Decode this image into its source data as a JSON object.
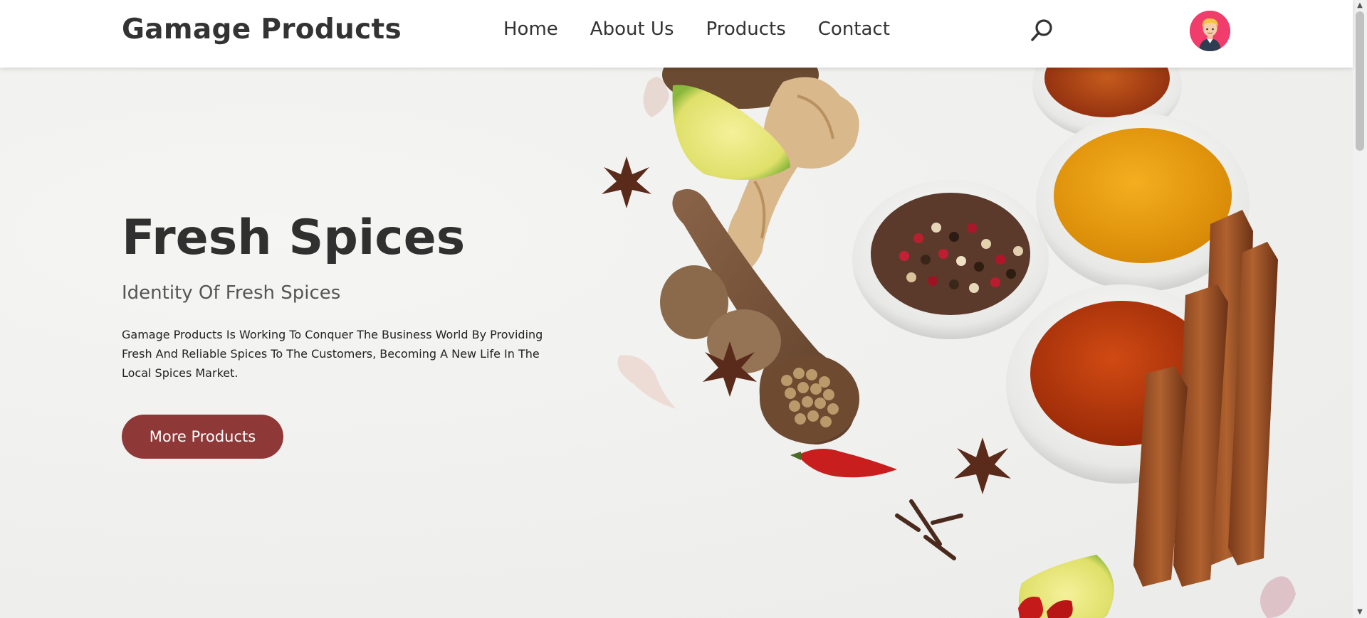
{
  "header": {
    "brand": "Gamage Products",
    "nav": [
      "Home",
      "About Us",
      "Products",
      "Contact"
    ]
  },
  "hero": {
    "title": "Fresh Spices",
    "subtitle": "Identity Of Fresh Spices",
    "description": "Gamage Products Is Working To Conquer The Business World By Providing Fresh And Reliable Spices To The Customers, Becoming A New Life In The Local Spices Market.",
    "cta_label": "More Products"
  },
  "colors": {
    "cta_background": "#8e3838",
    "avatar_background": "#f03d6b",
    "text_dark": "#333333"
  },
  "icons": {
    "search": "search-icon",
    "avatar": "user-avatar"
  }
}
